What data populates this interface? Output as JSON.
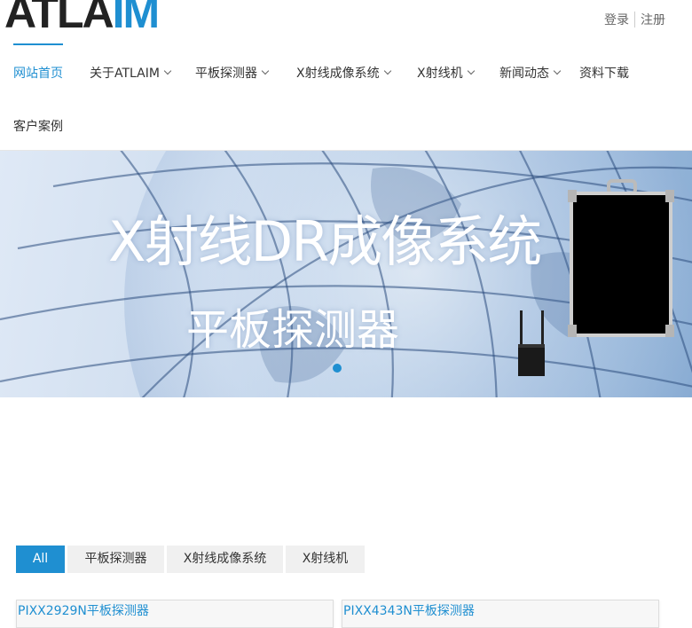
{
  "header": {
    "logo": {
      "text_main": "ATLA",
      "text_accent": "IM"
    },
    "auth": {
      "login": "登录",
      "register": "注册"
    }
  },
  "nav": {
    "items": [
      {
        "label": "网站首页",
        "has_dropdown": false,
        "active": true
      },
      {
        "label": "关于ATLAIM",
        "has_dropdown": true
      },
      {
        "label": "平板探测器",
        "has_dropdown": true
      },
      {
        "label": "X射线成像系统",
        "has_dropdown": true
      },
      {
        "label": "X射线机",
        "has_dropdown": true
      },
      {
        "label": "新闻动态",
        "has_dropdown": true
      },
      {
        "label": "资料下载",
        "has_dropdown": false
      },
      {
        "label": "客户案例",
        "has_dropdown": false
      }
    ]
  },
  "banner": {
    "title": "X射线DR成像系统",
    "subtitle": "平板探测器",
    "slide_count": 1,
    "active_slide": 1
  },
  "filters": {
    "tabs": [
      "All",
      "平板探测器",
      "X射线成像系统",
      "X射线机"
    ],
    "active": "All"
  },
  "products": [
    {
      "name": "PIXX2929N平板探测器"
    },
    {
      "name": "PIXX4343N平板探测器"
    }
  ],
  "colors": {
    "accent": "#1f8fd1",
    "text": "#333333",
    "tab_bg": "#f0f0f0"
  }
}
